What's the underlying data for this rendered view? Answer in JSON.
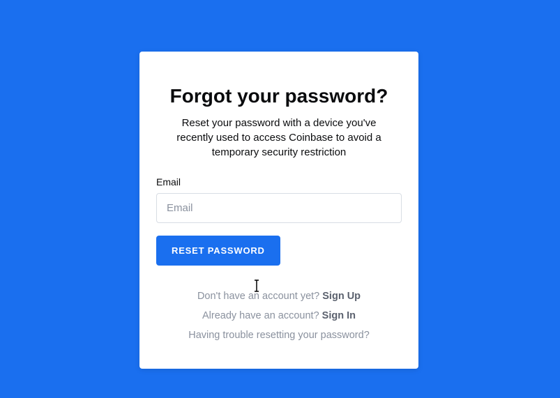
{
  "card": {
    "title": "Forgot your password?",
    "subtitle": "Reset your password with a device you've recently used to access Coinbase to avoid a temporary security restriction",
    "email_label": "Email",
    "email_placeholder": "Email",
    "email_value": "",
    "reset_button": "RESET PASSWORD",
    "signup_prompt": "Don't have an account yet? ",
    "signup_link": "Sign Up",
    "signin_prompt": "Already have an account? ",
    "signin_link": "Sign In",
    "trouble_link": "Having trouble resetting your password?"
  }
}
